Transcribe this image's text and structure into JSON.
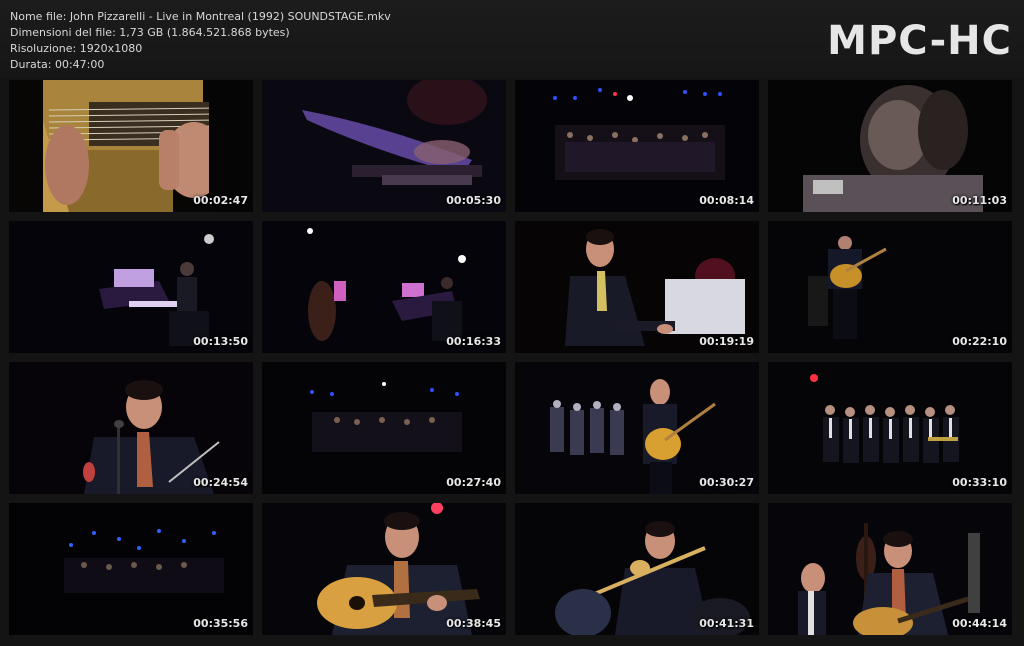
{
  "info": {
    "filename": "Nome file: John Pizzarelli - Live in Montreal (1992) SOUNDSTAGE.mkv",
    "filesize": "Dimensioni del file: 1,73 GB (1.864.521.868 bytes)",
    "resolution": "Risoluzione: 1920x1080",
    "duration": "Durata: 00:47:00"
  },
  "logo": "MPC-HC",
  "thumbnails": [
    {
      "time": "00:02:47",
      "scene": "guitar-closeup"
    },
    {
      "time": "00:05:30",
      "scene": "hands-blur"
    },
    {
      "time": "00:08:14",
      "scene": "stage-wide"
    },
    {
      "time": "00:11:03",
      "scene": "face-closeup"
    },
    {
      "time": "00:13:50",
      "scene": "piano-stage"
    },
    {
      "time": "00:16:33",
      "scene": "bass-piano"
    },
    {
      "time": "00:19:19",
      "scene": "pianist"
    },
    {
      "time": "00:22:10",
      "scene": "guitarist-small"
    },
    {
      "time": "00:24:54",
      "scene": "singer-mic"
    },
    {
      "time": "00:27:40",
      "scene": "stage-dark"
    },
    {
      "time": "00:30:27",
      "scene": "guitarist-band"
    },
    {
      "time": "00:33:10",
      "scene": "horn-section"
    },
    {
      "time": "00:35:56",
      "scene": "stage-lights"
    },
    {
      "time": "00:38:45",
      "scene": "guitarist-close"
    },
    {
      "time": "00:41:31",
      "scene": "trombone"
    },
    {
      "time": "00:44:14",
      "scene": "trio"
    }
  ]
}
